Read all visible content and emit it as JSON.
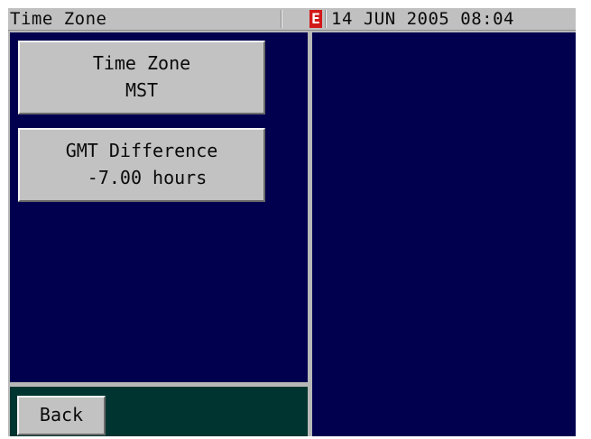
{
  "titlebar": {
    "title": "Time Zone",
    "status_badge": "E",
    "datetime": "14 JUN 2005 08:04"
  },
  "buttons": {
    "time_zone": {
      "label": "Time Zone",
      "value": "MST"
    },
    "gmt_difference": {
      "label": "GMT Difference",
      "value": " -7.00 hours"
    },
    "back": {
      "label": "Back"
    }
  }
}
